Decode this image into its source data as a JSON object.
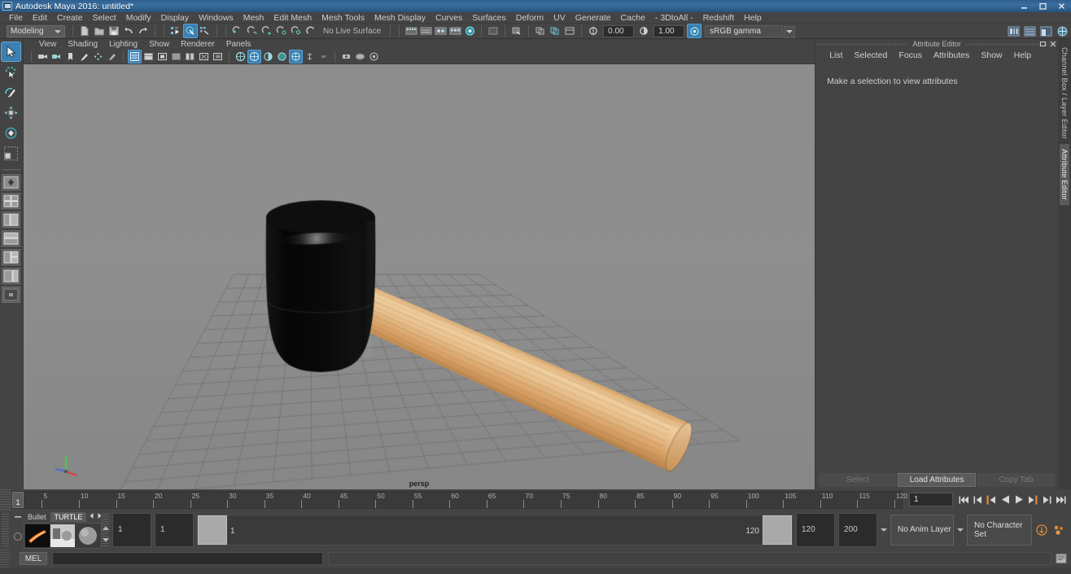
{
  "window": {
    "title": "Autodesk Maya 2016: untitled*",
    "app_icon": "maya-icon",
    "controls": {
      "minimize": "minimize-icon",
      "restore": "restore-icon",
      "close": "close-icon"
    }
  },
  "menubar": {
    "items": [
      "File",
      "Edit",
      "Create",
      "Select",
      "Modify",
      "Display",
      "Windows",
      "Mesh",
      "Edit Mesh",
      "Mesh Tools",
      "Mesh Display",
      "Curves",
      "Surfaces",
      "Deform",
      "UV",
      "Generate",
      "Cache",
      "- 3DtoAll -",
      "Redshift",
      "Help"
    ]
  },
  "statusline": {
    "menuset": "Modeling",
    "live_surface": "No Live Surface",
    "snap_value_1": "0.00",
    "snap_value_2": "1.00",
    "color_management": "sRGB gamma",
    "icons_group_file": [
      "new-scene-icon",
      "open-scene-icon",
      "save-scene-icon",
      "undo-icon",
      "redo-icon"
    ],
    "icons_group_select": [
      "select-by-hierarchy-icon",
      "select-by-object-icon",
      "select-by-component-icon"
    ],
    "icons_group_snap": [
      "snap-to-grid-icon",
      "snap-to-curve-icon",
      "snap-to-point-icon",
      "snap-to-projected-center-icon",
      "snap-to-view-plane-icon",
      "make-live-icon"
    ],
    "icons_group_editors": [
      "render-view-icon",
      "render-settings-icon",
      "hypershade-icon",
      "render-sequence-icon",
      "ipr-render-icon"
    ],
    "icons_group_right": [
      "attribute-editor-toggle-icon",
      "channel-box-toggle-icon",
      "tool-settings-toggle-icon",
      "help-toggle-icon"
    ]
  },
  "toolbox": {
    "tools": [
      {
        "name": "select-tool",
        "selected": true
      },
      {
        "name": "lasso-tool",
        "selected": false
      },
      {
        "name": "paint-select-tool",
        "selected": false
      },
      {
        "name": "move-tool",
        "selected": false
      },
      {
        "name": "rotate-tool",
        "selected": false
      },
      {
        "name": "scale-tool",
        "selected": false
      },
      {
        "name": "last-tool-used",
        "selected": false
      }
    ],
    "layouts": [
      "single-perspective-layout",
      "four-view-layout",
      "persp-outliner-layout",
      "persp-graph-layout",
      "persp-hypershade-layout",
      "persp-uv-layout",
      "persp-blank-layout"
    ]
  },
  "viewport": {
    "panel_menu": [
      "View",
      "Shading",
      "Lighting",
      "Show",
      "Renderer",
      "Panels"
    ],
    "camera_label": "persp",
    "toolbar_icons": [
      "select-camera-icon",
      "camera-attributes-icon",
      "bookmark-icon",
      "image-plane-icon",
      "two-d-pan-zoom-icon",
      "grease-pencil-icon",
      "wireframe-icon",
      "smooth-shade-all-icon",
      "shade-selected-icon",
      "wireframe-on-shaded-icon",
      "textured-icon",
      "lights-icon",
      "shadows-icon",
      "screen-space-ao-icon",
      "motion-blur-icon",
      "multisample-icon",
      "depth-peel-icon",
      "xray-icon",
      "xray-joints-icon",
      "exposure-icon",
      "gamma-icon",
      "isolate-select-icon"
    ],
    "gizmo": {
      "x_axis_color": "#d04545",
      "y_axis_color": "#4fc24f",
      "z_axis_color": "#4a6fd0"
    },
    "scene": {
      "objects": [
        {
          "name": "mallet-head",
          "color": "#0b0b0b"
        },
        {
          "name": "mallet-handle",
          "color": "#e0b077"
        }
      ],
      "ground_color": "#8b8b8b",
      "grid_color": "#6f6f6f"
    }
  },
  "attribute_editor": {
    "title": "Attribute Editor",
    "menu": [
      "List",
      "Selected",
      "Focus",
      "Attributes",
      "Show",
      "Help"
    ],
    "empty_message": "Make a selection to view attributes",
    "buttons": [
      {
        "label": "Select",
        "enabled": false
      },
      {
        "label": "Load Attributes",
        "enabled": true
      },
      {
        "label": "Copy Tab",
        "enabled": false
      }
    ]
  },
  "vertical_tabs": [
    {
      "label": "Channel Box / Layer Editor",
      "active": false
    },
    {
      "label": "Attribute Editor",
      "active": true
    }
  ],
  "time_slider": {
    "current_frame": "1",
    "start": 1,
    "end": 120,
    "ticks": [
      {
        "value": "5",
        "frame": 5
      },
      {
        "value": "10",
        "frame": 10
      },
      {
        "value": "15",
        "frame": 15
      },
      {
        "value": "20",
        "frame": 20
      },
      {
        "value": "25",
        "frame": 25
      },
      {
        "value": "30",
        "frame": 30
      },
      {
        "value": "35",
        "frame": 35
      },
      {
        "value": "40",
        "frame": 40
      },
      {
        "value": "45",
        "frame": 45
      },
      {
        "value": "50",
        "frame": 50
      },
      {
        "value": "55",
        "frame": 55
      },
      {
        "value": "60",
        "frame": 60
      },
      {
        "value": "65",
        "frame": 65
      },
      {
        "value": "70",
        "frame": 70
      },
      {
        "value": "75",
        "frame": 75
      },
      {
        "value": "80",
        "frame": 80
      },
      {
        "value": "85",
        "frame": 85
      },
      {
        "value": "90",
        "frame": 90
      },
      {
        "value": "95",
        "frame": 95
      },
      {
        "value": "100",
        "frame": 100
      },
      {
        "value": "105",
        "frame": 105
      },
      {
        "value": "110",
        "frame": 110
      },
      {
        "value": "115",
        "frame": 115
      },
      {
        "value": "120",
        "frame": 120
      }
    ],
    "frame_field": "1",
    "playback_buttons": [
      "go-to-start-icon",
      "step-back-frame-icon",
      "step-back-key-icon",
      "play-backwards-icon",
      "play-forwards-icon",
      "step-forward-key-icon",
      "step-forward-frame-icon",
      "go-to-end-icon"
    ]
  },
  "shelf": {
    "tabs": [
      {
        "label": "Bullet",
        "active": false
      },
      {
        "label": "TURTLE",
        "active": true
      }
    ],
    "arrows": [
      "shelf-prev-icon",
      "shelf-next-icon"
    ],
    "items": [
      "turtle-bake-icon",
      "turtle-render-icon",
      "turtle-material-icon"
    ]
  },
  "range_slider": {
    "anim_start": "1",
    "anim_end": "1",
    "playback_start_label": "1",
    "playback_end_label": "120",
    "range_start": "120",
    "range_end": "200",
    "anim_layer": "No Anim Layer",
    "character_set": "No Character Set",
    "auto_key_icon": "auto-keyframe-icon",
    "anim_prefs_icon": "animation-preferences-icon"
  },
  "command_line": {
    "language_label": "MEL",
    "input_value": "",
    "input_placeholder": "",
    "output_value": "",
    "script_editor_icon": "script-editor-icon"
  }
}
